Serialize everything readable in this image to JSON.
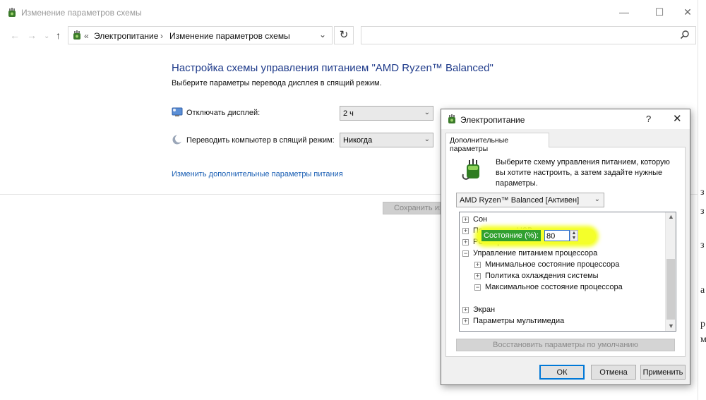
{
  "main_window": {
    "title": "Изменение параметров схемы",
    "controls": {
      "minimize": "—",
      "maximize": "☐",
      "close": "✕"
    },
    "nav": {
      "back": "←",
      "forward": "→",
      "recent": "⌄",
      "up": "↑"
    },
    "breadcrumb": {
      "prefix": "«",
      "root": "Электропитание",
      "separator": "›",
      "current": "Изменение параметров схемы",
      "dropdown": "⌄"
    },
    "refresh": "↻",
    "search": {
      "placeholder": ""
    }
  },
  "content": {
    "heading": "Настройка схемы управления питанием \"AMD Ryzen™ Balanced\"",
    "subheading": "Выберите параметры перевода дисплея в спящий режим.",
    "display_off": {
      "label": "Отключать дисплей:",
      "value": "2 ч"
    },
    "sleep": {
      "label": "Переводить компьютер в спящий режим:",
      "value": "Никогда"
    },
    "advanced_link": "Изменить дополнительные параметры питания",
    "save_button": "Сохранить изменения"
  },
  "dialog": {
    "title": "Электропитание",
    "help": "?",
    "close": "✕",
    "tab": "Дополнительные параметры",
    "description": "Выберите схему управления питанием, которую вы хотите настроить, а затем задайте нужные параметры.",
    "plan": "AMD Ryzen™ Balanced [Активен]",
    "tree": [
      {
        "label": "Сон",
        "expander": "+",
        "level": 0
      },
      {
        "label": "Параметры USB",
        "expander": "+",
        "level": 0
      },
      {
        "label": "PCI Express",
        "expander": "+",
        "level": 0
      },
      {
        "label": "Управление питанием процессора",
        "expander": "−",
        "level": 0
      },
      {
        "label": "Минимальное состояние процессора",
        "expander": "+",
        "level": 1
      },
      {
        "label": "Политика охлаждения системы",
        "expander": "+",
        "level": 1
      },
      {
        "label": "Максимальное состояние процессора",
        "expander": "−",
        "level": 1
      },
      {
        "label": "Экран",
        "expander": "+",
        "level": 0
      },
      {
        "label": "Параметры мультимедиа",
        "expander": "+",
        "level": 0
      }
    ],
    "state": {
      "label": "Состояние (%):",
      "value": "80"
    },
    "restore_button": "Восстановить параметры по умолчанию",
    "buttons": {
      "ok": "ОК",
      "cancel": "Отмена",
      "apply": "Применить"
    }
  },
  "right_edge_glyphs": [
    "з",
    "з",
    "з",
    "а",
    "р",
    "м"
  ],
  "colors": {
    "heading": "#1e3a8a",
    "link": "#1a5fb4",
    "highlight": "#f4ff2a",
    "state_label_bg": "#31a02f",
    "ok_border": "#0078d7"
  }
}
